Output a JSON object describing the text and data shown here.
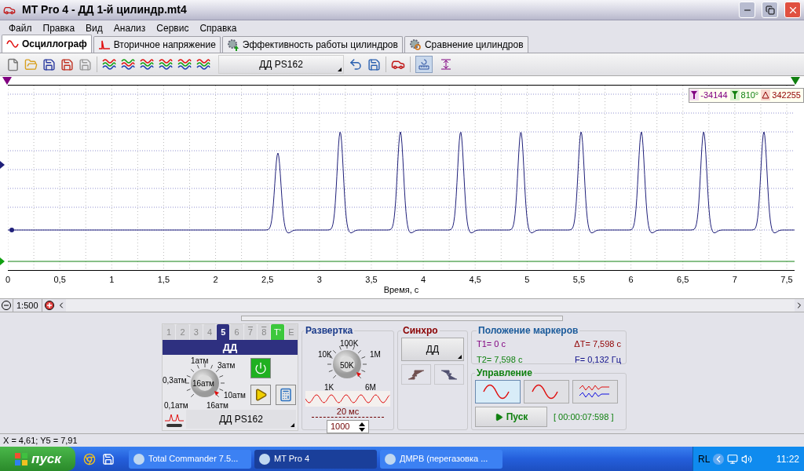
{
  "window": {
    "title": "MT Pro 4 - ДД 1-й цилиндр.mt4"
  },
  "menu": [
    "Файл",
    "Правка",
    "Вид",
    "Анализ",
    "Сервис",
    "Справка"
  ],
  "tabs": [
    {
      "label": "Осциллограф",
      "selected": true,
      "kind": "scope"
    },
    {
      "label": "Вторичное напряжение",
      "selected": false,
      "kind": "spark"
    },
    {
      "label": "Эффективность работы цилиндров",
      "selected": false,
      "kind": "gear"
    },
    {
      "label": "Сравнение цилиндров",
      "selected": false,
      "kind": "compare"
    }
  ],
  "toolbar": {
    "sensor_select": "ДД PS162",
    "view_toggles": [
      {
        "selected": true
      },
      {
        "selected": false
      }
    ]
  },
  "chart": {
    "marker_readout": [
      {
        "kind": "t1",
        "text": "-34144"
      },
      {
        "kind": "t2",
        "text": "810°"
      },
      {
        "kind": "delta",
        "text": "342255"
      }
    ],
    "x_ticks": [
      "0",
      "0,5",
      "1",
      "1,5",
      "2",
      "2,5",
      "3",
      "3,5",
      "4",
      "4,5",
      "5",
      "5,5",
      "6",
      "6,5",
      "7",
      "7,5"
    ],
    "x_axis_label": "Время, с"
  },
  "zoom": {
    "scale": "1:500"
  },
  "channel_panel": {
    "channels": [
      {
        "label": "1",
        "selected": false,
        "kind": "plain"
      },
      {
        "label": "2",
        "selected": false,
        "kind": "plain"
      },
      {
        "label": "3",
        "selected": false,
        "kind": "plain"
      },
      {
        "label": "4",
        "selected": false,
        "kind": "plain"
      },
      {
        "label": "5",
        "selected": true,
        "kind": "plain"
      },
      {
        "label": "6",
        "selected": false,
        "kind": "plain"
      },
      {
        "label": "7",
        "selected": false,
        "kind": "inverted"
      },
      {
        "label": "8",
        "selected": false,
        "kind": "inverted"
      },
      {
        "label": "T'",
        "selected": false,
        "kind": "trigger"
      },
      {
        "label": "E",
        "selected": false,
        "kind": "plain"
      }
    ],
    "channel_name": "ДД",
    "dial_center": "16атм",
    "dial_labels": [
      "1атм",
      "3атм",
      "0,3атм",
      "10атм",
      "0,1атм",
      "16атм"
    ],
    "sensor": "ДД PS162"
  },
  "sweep": {
    "title": "Развертка",
    "dial_center": "50K",
    "dial_labels": [
      "100K",
      "10K",
      "1M",
      "1K",
      "6M"
    ],
    "period": "20 мс",
    "value": "1000"
  },
  "sync": {
    "title": "Синхро",
    "source": "ДД"
  },
  "markers": {
    "title": "Положение маркеров",
    "t1": "T1= 0 с",
    "dt": "ΔT= 7,598 с",
    "t2": "T2= 7,598 с",
    "f": "F= 0,132 Гц"
  },
  "control": {
    "title": "Управление",
    "modes": [
      {
        "selected": true
      },
      {
        "selected": false
      },
      {
        "selected": false
      }
    ],
    "start": "Пуск",
    "timer": "[ 00:00:07:598 ]"
  },
  "status_bar": "X = 4,61; Y5 = 7,91",
  "taskbar": {
    "start": "пуск",
    "tasks": [
      {
        "label": "Total Commander 7.5...",
        "selected": false
      },
      {
        "label": "MT Pro 4",
        "selected": true
      },
      {
        "label": "ДМРВ (перегазовка ...",
        "selected": false
      }
    ],
    "tray_text": "RL",
    "clock": "11:22"
  }
}
